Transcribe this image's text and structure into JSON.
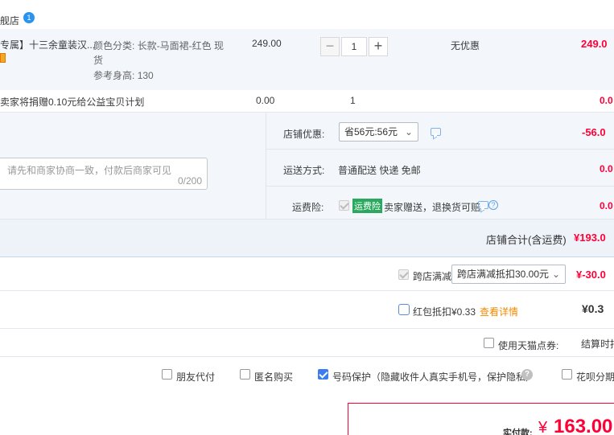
{
  "shop": {
    "name": "舰店",
    "badge": "1"
  },
  "item": {
    "title": "专属】十三余童装汉...",
    "sku_label_1": "颜色分类:",
    "sku_value_1": "长款-马面裙-红色 现",
    "sku_value_1b": "货",
    "sku_label_2": "参考身高:",
    "sku_value_2": "130",
    "price": "249.00",
    "quantity": "1",
    "minus": "−",
    "plus": "+",
    "promo": "无优惠",
    "subtotal": "249.0"
  },
  "charity": {
    "title": "卖家将捐赠0.10元给公益宝贝计划",
    "price": "0.00",
    "quantity": "1",
    "subtotal": "0.0"
  },
  "message": {
    "placeholder": "请先和商家协商一致，付款后商家可见",
    "counter": "0/200"
  },
  "shop_discount": {
    "label": "店铺优惠:",
    "selected": "省56元:56元",
    "amount": "-56.0"
  },
  "shipping": {
    "label": "运送方式:",
    "value": "普通配送 快递 免邮",
    "amount": "0.0"
  },
  "insurance": {
    "label": "运费险:",
    "tag": "运费险",
    "text": "卖家赠送，退换货可赔",
    "amount": "0.0"
  },
  "shop_total": {
    "label": "店铺合计(含运费)",
    "value": "¥193.0"
  },
  "cross_store": {
    "label": "跨店满减",
    "selected": "跨店满减抵扣30.00元",
    "amount": "¥-30.0"
  },
  "redpacket": {
    "label": "红包抵扣¥0.33",
    "link": "查看详情",
    "amount": "¥0.3"
  },
  "tmall_points": {
    "label": "使用天猫点券:",
    "note": "结算时扣"
  },
  "options": {
    "friend_pay": "朋友代付",
    "anonymous": "匿名购买",
    "number_protect": "号码保护（隐藏收件人真实手机号，保护隐私）",
    "huabei": "花呗分期"
  },
  "payment": {
    "label": "实付款:",
    "symbol": "¥",
    "amount": "163.00"
  },
  "colors": {
    "accent": "#ff0036",
    "band": "#f3f7fc",
    "link": "#f08a00",
    "tag_green": "#2aa85d"
  }
}
